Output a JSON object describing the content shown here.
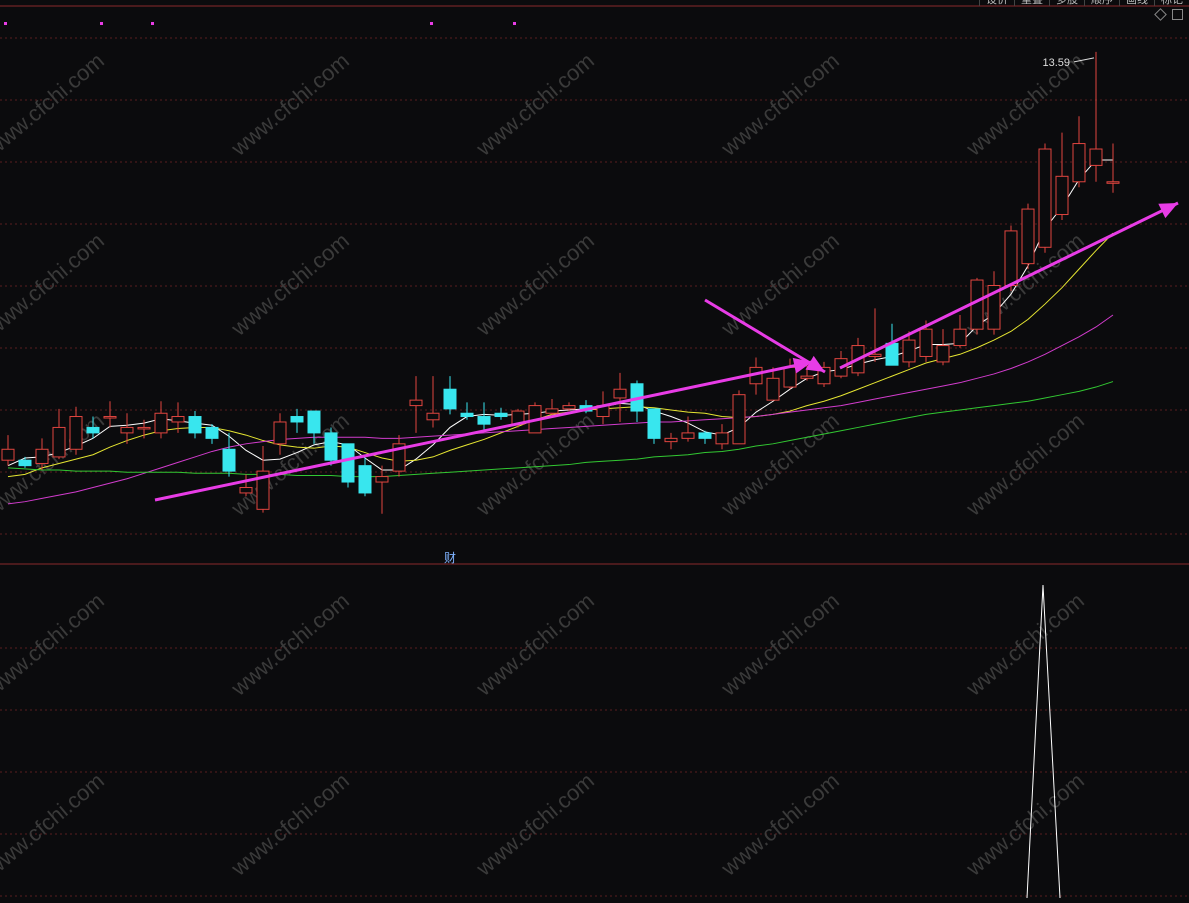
{
  "toolbar": {
    "tabs": [
      "设价",
      "重叠",
      "多股",
      "顺序",
      "画线",
      "标记"
    ]
  },
  "main_panel": {
    "price_label": "13.59",
    "finance_marker": "财"
  },
  "colors": {
    "up": "#e0453f",
    "down": "#38e6ee",
    "ma5": "#ffffff",
    "ma10": "#e6e632",
    "ma20": "#d23ccd",
    "ma60": "#32c832",
    "arrow": "#e83ce6",
    "grid": "#5a1e1e",
    "watermark": "#3a3a3a"
  },
  "watermark": "www.cfchi.com",
  "chart_data": {
    "type": "candlestick",
    "x": [
      1,
      2,
      3,
      4,
      5,
      6,
      7,
      8,
      9,
      10,
      11,
      12,
      13,
      14,
      15,
      16,
      17,
      18,
      19,
      20,
      21,
      22,
      23,
      24,
      25,
      26,
      27,
      28,
      29,
      30,
      31,
      32,
      33,
      34,
      35,
      36,
      37,
      38,
      39,
      40,
      41,
      42,
      43,
      44,
      45,
      46,
      47,
      48,
      49,
      50,
      51,
      52,
      53,
      54,
      55,
      56,
      57,
      58,
      59,
      60,
      61,
      62,
      63,
      64,
      65,
      66
    ],
    "open": [
      9.85,
      9.85,
      9.82,
      9.88,
      9.95,
      10.15,
      10.25,
      10.1,
      10.15,
      10.1,
      10.2,
      10.25,
      10.15,
      9.95,
      9.55,
      9.4,
      10.0,
      10.25,
      10.3,
      10.1,
      10.0,
      9.8,
      9.65,
      9.75,
      10.35,
      10.22,
      10.5,
      10.28,
      10.25,
      10.28,
      10.18,
      10.1,
      10.28,
      10.32,
      10.35,
      10.25,
      10.42,
      10.55,
      10.32,
      10.02,
      10.05,
      10.1,
      10.0,
      10.0,
      10.55,
      10.4,
      10.52,
      10.6,
      10.55,
      10.62,
      10.65,
      10.8,
      10.92,
      10.75,
      10.8,
      10.75,
      10.9,
      11.05,
      11.05,
      11.45,
      11.65,
      11.8,
      12.1,
      12.4,
      12.55,
      12.4
    ],
    "close": [
      9.95,
      9.8,
      9.95,
      10.15,
      10.25,
      10.1,
      10.25,
      10.15,
      10.15,
      10.28,
      10.25,
      10.1,
      10.05,
      9.75,
      9.6,
      9.75,
      10.2,
      10.2,
      10.1,
      9.85,
      9.65,
      9.55,
      9.7,
      10.0,
      10.4,
      10.28,
      10.32,
      10.25,
      10.18,
      10.25,
      10.3,
      10.35,
      10.32,
      10.35,
      10.3,
      10.35,
      10.5,
      10.3,
      10.05,
      10.05,
      10.1,
      10.05,
      10.1,
      10.45,
      10.7,
      10.6,
      10.7,
      10.62,
      10.7,
      10.78,
      10.9,
      10.82,
      10.72,
      10.95,
      11.05,
      10.9,
      11.05,
      11.5,
      11.45,
      11.95,
      12.15,
      12.7,
      12.45,
      12.75,
      12.7,
      12.4
    ],
    "high": [
      10.08,
      9.88,
      10.05,
      10.32,
      10.34,
      10.25,
      10.39,
      10.28,
      10.22,
      10.39,
      10.38,
      10.3,
      10.18,
      10.1,
      9.72,
      9.98,
      10.28,
      10.32,
      10.3,
      10.15,
      10.0,
      9.88,
      9.8,
      10.08,
      10.62,
      10.62,
      10.62,
      10.38,
      10.38,
      10.33,
      10.32,
      10.38,
      10.41,
      10.38,
      10.4,
      10.48,
      10.65,
      10.58,
      10.32,
      10.1,
      10.25,
      10.12,
      10.18,
      10.49,
      10.79,
      10.7,
      10.78,
      10.72,
      10.75,
      10.85,
      10.97,
      11.24,
      11.1,
      11.03,
      11.13,
      11.05,
      11.18,
      11.52,
      11.58,
      12.0,
      12.2,
      12.75,
      12.85,
      13.0,
      13.59,
      12.75
    ],
    "low": [
      9.8,
      9.78,
      9.76,
      9.86,
      9.9,
      10.05,
      10.15,
      10.0,
      10.05,
      10.05,
      10.1,
      10.05,
      10.0,
      9.7,
      9.52,
      9.37,
      9.9,
      10.1,
      10.0,
      9.8,
      9.6,
      9.52,
      9.36,
      9.7,
      10.1,
      10.15,
      10.27,
      10.22,
      10.12,
      10.22,
      10.15,
      10.1,
      10.26,
      10.3,
      10.28,
      10.18,
      10.2,
      10.2,
      10.0,
      9.95,
      10.02,
      10.0,
      9.95,
      10.0,
      10.45,
      10.4,
      10.5,
      10.58,
      10.52,
      10.6,
      10.62,
      10.75,
      10.88,
      10.7,
      10.75,
      10.72,
      10.88,
      11.0,
      11.0,
      11.4,
      11.6,
      11.75,
      12.05,
      12.35,
      12.4,
      12.3
    ],
    "moving_averages": [
      {
        "name": "MA5",
        "color": "#ffffff",
        "values": [
          9.8,
          9.87,
          9.88,
          9.92,
          9.98,
          10.05,
          10.16,
          10.17,
          10.19,
          10.23,
          10.21,
          10.19,
          10.17,
          10.07,
          9.94,
          9.85,
          9.86,
          9.92,
          9.99,
          10.02,
          9.99,
          9.87,
          9.76,
          9.76,
          9.86,
          9.99,
          10.15,
          10.25,
          10.27,
          10.26,
          10.27,
          10.28,
          10.3,
          10.31,
          10.32,
          10.34,
          10.37,
          10.36,
          10.3,
          10.25,
          10.19,
          10.11,
          10.08,
          10.15,
          10.29,
          10.39,
          10.5,
          10.6,
          10.66,
          10.68,
          10.73,
          10.77,
          10.8,
          10.85,
          10.91,
          10.91,
          10.92,
          11.08,
          11.19,
          11.37,
          11.63,
          11.97,
          12.17,
          12.42,
          12.6,
          12.6
        ]
      },
      {
        "name": "MA10",
        "color": "#e6e632",
        "values": [
          9.7,
          9.72,
          9.78,
          9.82,
          9.86,
          9.9,
          9.97,
          10.03,
          10.08,
          10.12,
          10.14,
          10.15,
          10.15,
          10.12,
          10.08,
          10.03,
          9.99,
          9.97,
          9.96,
          9.98,
          9.97,
          9.92,
          9.87,
          9.84,
          9.85,
          9.88,
          9.94,
          9.99,
          10.04,
          10.1,
          10.16,
          10.22,
          10.27,
          10.29,
          10.31,
          10.32,
          10.33,
          10.34,
          10.33,
          10.31,
          10.29,
          10.28,
          10.25,
          10.24,
          10.25,
          10.27,
          10.3,
          10.35,
          10.39,
          10.44,
          10.5,
          10.56,
          10.62,
          10.68,
          10.74,
          10.78,
          10.82,
          10.88,
          10.95,
          11.03,
          11.14,
          11.28,
          11.43,
          11.6,
          11.77,
          11.93
        ]
      },
      {
        "name": "MA20",
        "color": "#d23ccd",
        "values": [
          9.45,
          9.47,
          9.5,
          9.53,
          9.56,
          9.6,
          9.64,
          9.68,
          9.73,
          9.78,
          9.83,
          9.88,
          9.93,
          9.97,
          10.0,
          10.02,
          10.04,
          10.05,
          10.06,
          10.06,
          10.06,
          10.06,
          10.05,
          10.05,
          10.06,
          10.07,
          10.08,
          10.09,
          10.1,
          10.11,
          10.12,
          10.13,
          10.14,
          10.15,
          10.16,
          10.17,
          10.18,
          10.19,
          10.2,
          10.2,
          10.21,
          10.22,
          10.23,
          10.24,
          10.25,
          10.27,
          10.29,
          10.31,
          10.33,
          10.35,
          10.38,
          10.41,
          10.44,
          10.47,
          10.5,
          10.53,
          10.56,
          10.6,
          10.64,
          10.69,
          10.75,
          10.82,
          10.9,
          10.98,
          11.07,
          11.18
        ]
      },
      {
        "name": "MA60",
        "color": "#32c832",
        "values": [
          9.78,
          9.77,
          9.76,
          9.76,
          9.75,
          9.75,
          9.75,
          9.74,
          9.74,
          9.74,
          9.74,
          9.73,
          9.73,
          9.73,
          9.72,
          9.72,
          9.72,
          9.71,
          9.71,
          9.71,
          9.7,
          9.7,
          9.7,
          9.71,
          9.72,
          9.73,
          9.74,
          9.75,
          9.76,
          9.77,
          9.78,
          9.79,
          9.8,
          9.81,
          9.83,
          9.84,
          9.85,
          9.86,
          9.88,
          9.89,
          9.9,
          9.92,
          9.93,
          9.95,
          9.98,
          10.0,
          10.03,
          10.06,
          10.09,
          10.12,
          10.15,
          10.18,
          10.21,
          10.24,
          10.27,
          10.29,
          10.31,
          10.33,
          10.35,
          10.37,
          10.39,
          10.42,
          10.45,
          10.48,
          10.52,
          10.57
        ]
      }
    ],
    "annotations": [
      {
        "x": 65,
        "y": 13.59,
        "text": "13.59"
      }
    ],
    "ylim": [
      9.0,
      13.9
    ],
    "grid": true,
    "indicator": {
      "type": "line",
      "x": [
        59,
        60,
        61,
        62,
        63,
        64,
        65,
        66
      ],
      "values": [
        0,
        0,
        0,
        0,
        0,
        0,
        0,
        0
      ],
      "spike": {
        "x": 61,
        "value": 100
      },
      "ylim": [
        0,
        100
      ]
    }
  }
}
